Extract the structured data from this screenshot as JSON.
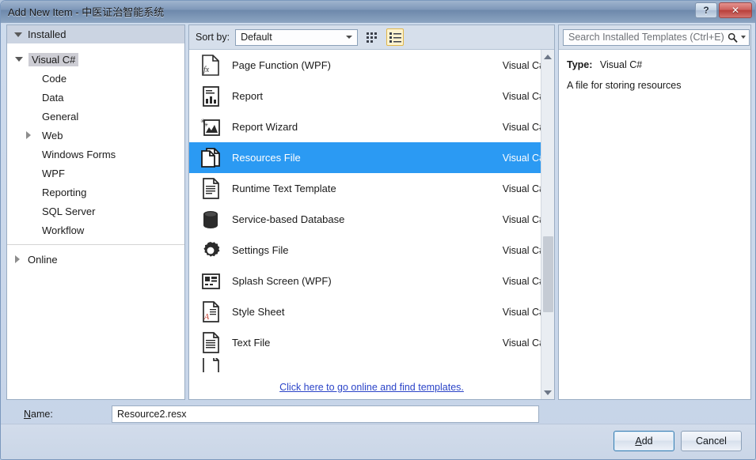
{
  "window": {
    "title": "Add New Item - 中医证治智能系统",
    "help_button": "?",
    "close_button": "✕"
  },
  "sidebar": {
    "header": "Installed",
    "root": "Visual C#",
    "items": [
      {
        "label": "Code"
      },
      {
        "label": "Data"
      },
      {
        "label": "General"
      },
      {
        "label": "Web"
      },
      {
        "label": "Windows Forms"
      },
      {
        "label": "WPF"
      },
      {
        "label": "Reporting"
      },
      {
        "label": "SQL Server"
      },
      {
        "label": "Workflow"
      }
    ],
    "online": "Online"
  },
  "toolbar": {
    "sort_label": "Sort by:",
    "sort_value": "Default",
    "grid_view_tooltip": "Medium Icons",
    "list_view_tooltip": "List"
  },
  "search": {
    "placeholder": "Search Installed Templates (Ctrl+E)"
  },
  "templates": [
    {
      "name": "Page Function (WPF)",
      "lang": "Visual C#",
      "icon": "page-function-icon",
      "selected": false
    },
    {
      "name": "Report",
      "lang": "Visual C#",
      "icon": "report-icon",
      "selected": false
    },
    {
      "name": "Report Wizard",
      "lang": "Visual C#",
      "icon": "report-wizard-icon",
      "selected": false
    },
    {
      "name": "Resources File",
      "lang": "Visual C#",
      "icon": "resources-file-icon",
      "selected": true
    },
    {
      "name": "Runtime Text Template",
      "lang": "Visual C#",
      "icon": "runtime-text-template-icon",
      "selected": false
    },
    {
      "name": "Service-based Database",
      "lang": "Visual C#",
      "icon": "database-icon",
      "selected": false
    },
    {
      "name": "Settings File",
      "lang": "Visual C#",
      "icon": "settings-file-icon",
      "selected": false
    },
    {
      "name": "Splash Screen (WPF)",
      "lang": "Visual C#",
      "icon": "splash-screen-icon",
      "selected": false
    },
    {
      "name": "Style Sheet",
      "lang": "Visual C#",
      "icon": "style-sheet-icon",
      "selected": false
    },
    {
      "name": "Text File",
      "lang": "Visual C#",
      "icon": "text-file-icon",
      "selected": false
    }
  ],
  "online_link": "Click here to go online and find templates.",
  "info": {
    "type_label": "Type:",
    "type_value": "Visual C#",
    "description": "A file for storing resources"
  },
  "name_field": {
    "label_prefix": "N",
    "label_rest": "ame:",
    "value": "Resource2.resx"
  },
  "footer": {
    "add_prefix": "A",
    "add_rest": "dd",
    "cancel": "Cancel"
  },
  "colors": {
    "selection_blue": "#2b9af3",
    "link_blue": "#2b44c8",
    "active_view_border": "#e0b64a",
    "close_red": "#b8403c"
  }
}
